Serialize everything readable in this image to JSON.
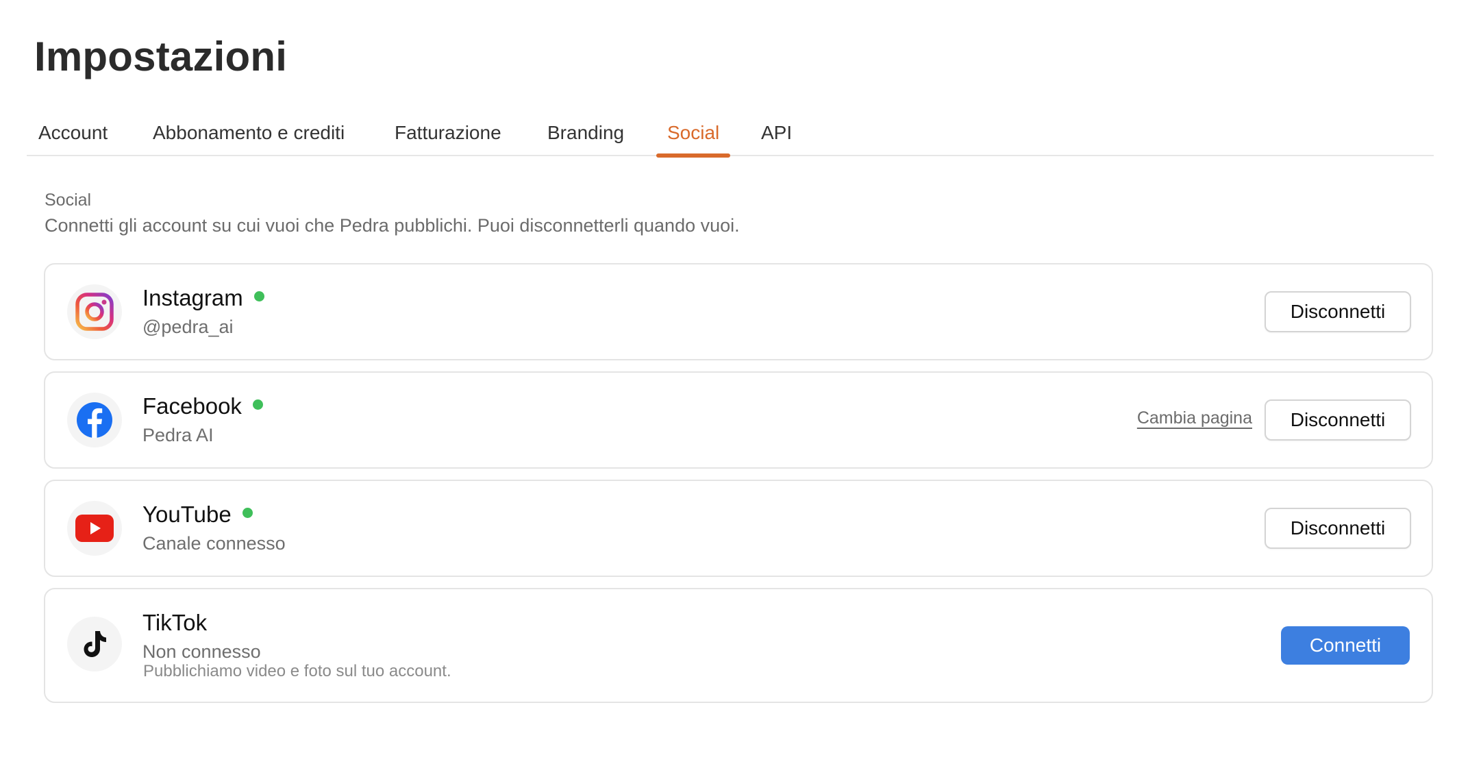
{
  "page": {
    "title": "Impostazioni"
  },
  "tabs": [
    {
      "label": "Account",
      "active": false
    },
    {
      "label": "Abbonamento e crediti",
      "active": false
    },
    {
      "label": "Fatturazione",
      "active": false
    },
    {
      "label": "Branding",
      "active": false
    },
    {
      "label": "Social",
      "active": true
    },
    {
      "label": "API",
      "active": false
    }
  ],
  "section": {
    "label": "Social",
    "description": "Connetti gli account su cui vuoi che Pedra pubblichi. Puoi disconnetterli quando vuoi."
  },
  "accounts": [
    {
      "name": "Instagram",
      "connected": true,
      "subtitle": "@pedra_ai",
      "icon": "instagram-icon",
      "action_label": "Disconnetti"
    },
    {
      "name": "Facebook",
      "connected": true,
      "subtitle": "Pedra AI",
      "icon": "facebook-icon",
      "secondary_link": "Cambia pagina",
      "action_label": "Disconnetti"
    },
    {
      "name": "YouTube",
      "connected": true,
      "subtitle": "Canale connesso",
      "icon": "youtube-icon",
      "action_label": "Disconnetti"
    },
    {
      "name": "TikTok",
      "connected": false,
      "subtitle": "Non connesso",
      "note": "Pubblichiamo video e foto sul tuo account.",
      "icon": "tiktok-icon",
      "action_label": "Connetti"
    }
  ],
  "colors": {
    "accent": "#d96a2b",
    "primary_button": "#3d7fe0",
    "connected_dot": "#3fbf5a",
    "border": "#e4e4e4"
  }
}
